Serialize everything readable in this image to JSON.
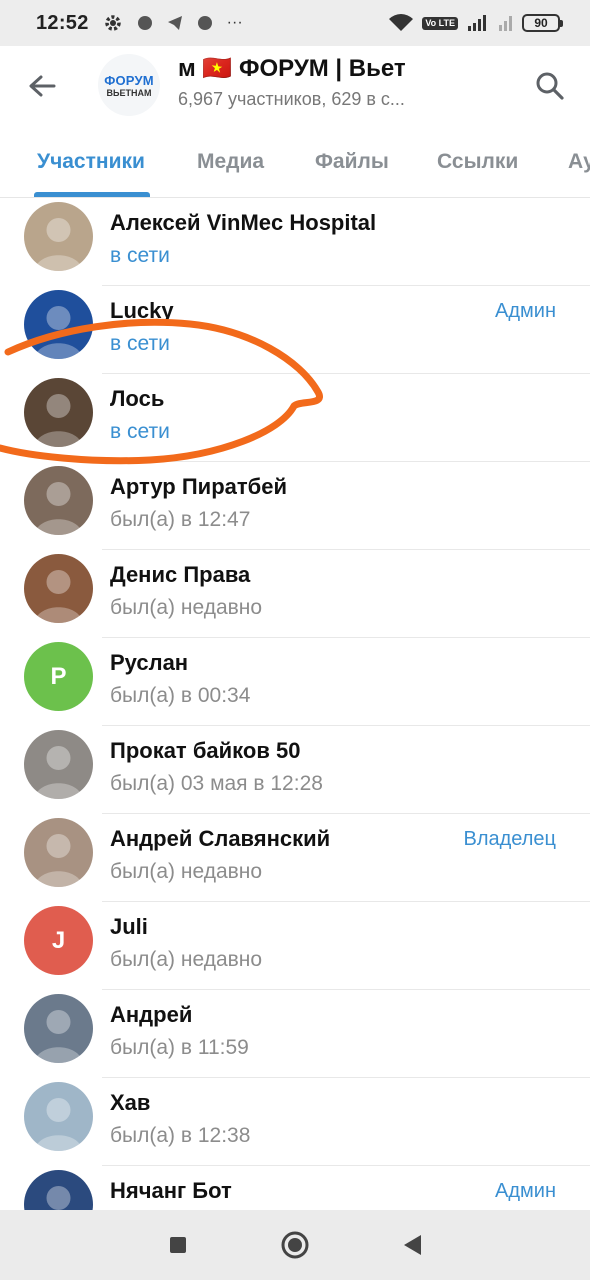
{
  "status_bar": {
    "time": "12:52",
    "battery": "90",
    "network": "4G",
    "volte": "Vo LTE"
  },
  "header": {
    "logo_top": "ФОРУМ",
    "logo_bottom": "ВЬЕТНАМ",
    "title": "м   🇻🇳 ФОРУМ | Вьет",
    "subtitle": "6,967 участников, 629 в с..."
  },
  "tabs": [
    {
      "label": "Участники"
    },
    {
      "label": "Медиа"
    },
    {
      "label": "Файлы"
    },
    {
      "label": "Ссылки"
    },
    {
      "label": "Ау"
    }
  ],
  "members": [
    {
      "name": "Алексей VinMec Hospital",
      "status": "в сети",
      "role": "",
      "avatar_letter": "",
      "avatar_color": "#b9a58c"
    },
    {
      "name": "Lucky",
      "status": "в сети",
      "role": "Админ",
      "avatar_letter": "",
      "avatar_color": "#1f4f9c"
    },
    {
      "name": "Лось",
      "status": "в сети",
      "role": "",
      "avatar_letter": "",
      "avatar_color": "#5a4636"
    },
    {
      "name": "Артур Пиратбей",
      "status": "был(а) в 12:47",
      "role": "",
      "avatar_letter": "",
      "avatar_color": "#7d6a5c"
    },
    {
      "name": "Денис Права",
      "status": "был(а) недавно",
      "role": "",
      "avatar_letter": "",
      "avatar_color": "#8a5a3e"
    },
    {
      "name": "Руслан",
      "status": "был(а) в 00:34",
      "role": "",
      "avatar_letter": "Р",
      "avatar_color": "#6cc14c"
    },
    {
      "name": "Прокат байков 50",
      "status": "был(а) 03 мая в 12:28",
      "role": "",
      "avatar_letter": "",
      "avatar_color": "#8e8a86"
    },
    {
      "name": "Андрей Славянский",
      "status": "был(а) недавно",
      "role": "Владелец",
      "avatar_letter": "",
      "avatar_color": "#a89282"
    },
    {
      "name": "Juli",
      "status": "был(а) недавно",
      "role": "",
      "avatar_letter": "J",
      "avatar_color": "#e05d4f"
    },
    {
      "name": "Андрей",
      "status": "был(а) в 11:59",
      "role": "",
      "avatar_letter": "",
      "avatar_color": "#6b7a8c"
    },
    {
      "name": "Хав",
      "status": "был(а) в 12:38",
      "role": "",
      "avatar_letter": "",
      "avatar_color": "#9fb6c8"
    },
    {
      "name": "Нячанг Бот",
      "status": "",
      "role": "Админ",
      "avatar_letter": "",
      "avatar_color": "#2b4a7e"
    }
  ],
  "colors": {
    "accent": "#3a8fd1",
    "annotation": "#f26a1b",
    "muted_text": "#8c8c8c"
  },
  "icons": {
    "back": "arrow-left-icon",
    "search": "search-icon",
    "nav_recents": "square-icon",
    "nav_home": "circle-icon",
    "nav_back": "triangle-left-icon"
  }
}
